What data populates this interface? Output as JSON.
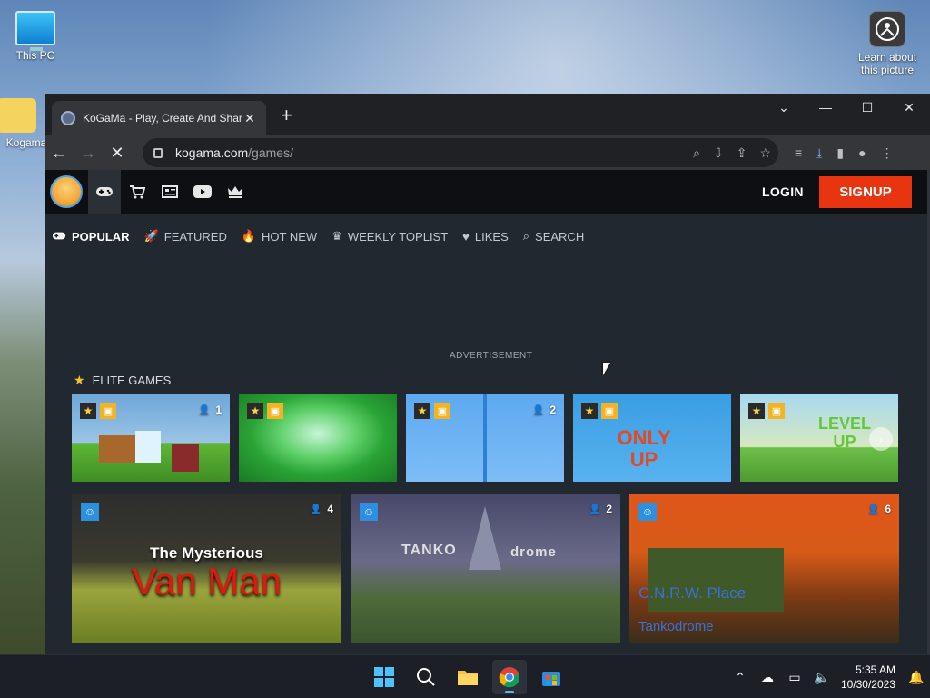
{
  "desktop": {
    "icons": [
      {
        "label": "This PC"
      },
      {
        "label": "Learn about this picture"
      },
      {
        "label": "Kogama"
      }
    ]
  },
  "browser": {
    "tab": {
      "title": "KoGaMa - Play, Create And Share",
      "close": "✕"
    },
    "new_tab": "+",
    "window_controls": {
      "tab_search": "⌄",
      "minimize": "—",
      "maximize": "☐",
      "close": "✕"
    },
    "address": {
      "host": "kogama.com",
      "path": "/games/"
    }
  },
  "site": {
    "header": {
      "login_label": "LOGIN",
      "signup_label": "SIGNUP",
      "icons": [
        "gamepad-icon",
        "cart-icon",
        "news-icon",
        "youtube-icon",
        "crown-icon"
      ]
    },
    "subnav": [
      {
        "label": "POPULAR",
        "icon": "gamepad-icon",
        "active": true
      },
      {
        "label": "FEATURED",
        "icon": "rocket-icon"
      },
      {
        "label": "HOT NEW",
        "icon": "fire-icon"
      },
      {
        "label": "WEEKLY TOPLIST",
        "icon": "crown-icon"
      },
      {
        "label": "LIKES",
        "icon": "heart-icon"
      },
      {
        "label": "SEARCH",
        "icon": "search-icon"
      }
    ],
    "advertisement_label": "ADVERTISEMENT",
    "elite_section_title": "ELITE GAMES",
    "elite_games": [
      {
        "players": "1"
      },
      {
        "players": ""
      },
      {
        "players": "2"
      },
      {
        "players": "",
        "title_text": "ONLY UP"
      },
      {
        "players": "",
        "title_text": "LEVEL UP"
      }
    ],
    "games": [
      {
        "players": "4",
        "title_line1": "The Mysterious",
        "title_line2": "Van Man"
      },
      {
        "players": "2",
        "title_line1": "TANKO",
        "title_line2": "drome"
      },
      {
        "players": "6",
        "title_line1": "C.N.R.W. Place",
        "title_line2": "Tankodrome"
      }
    ]
  },
  "taskbar": {
    "time": "5:35 AM",
    "date": "10/30/2023"
  },
  "colors": {
    "signup_bg": "#e8340f",
    "page_bg": "#222830",
    "header_bg": "#0d0f13"
  }
}
